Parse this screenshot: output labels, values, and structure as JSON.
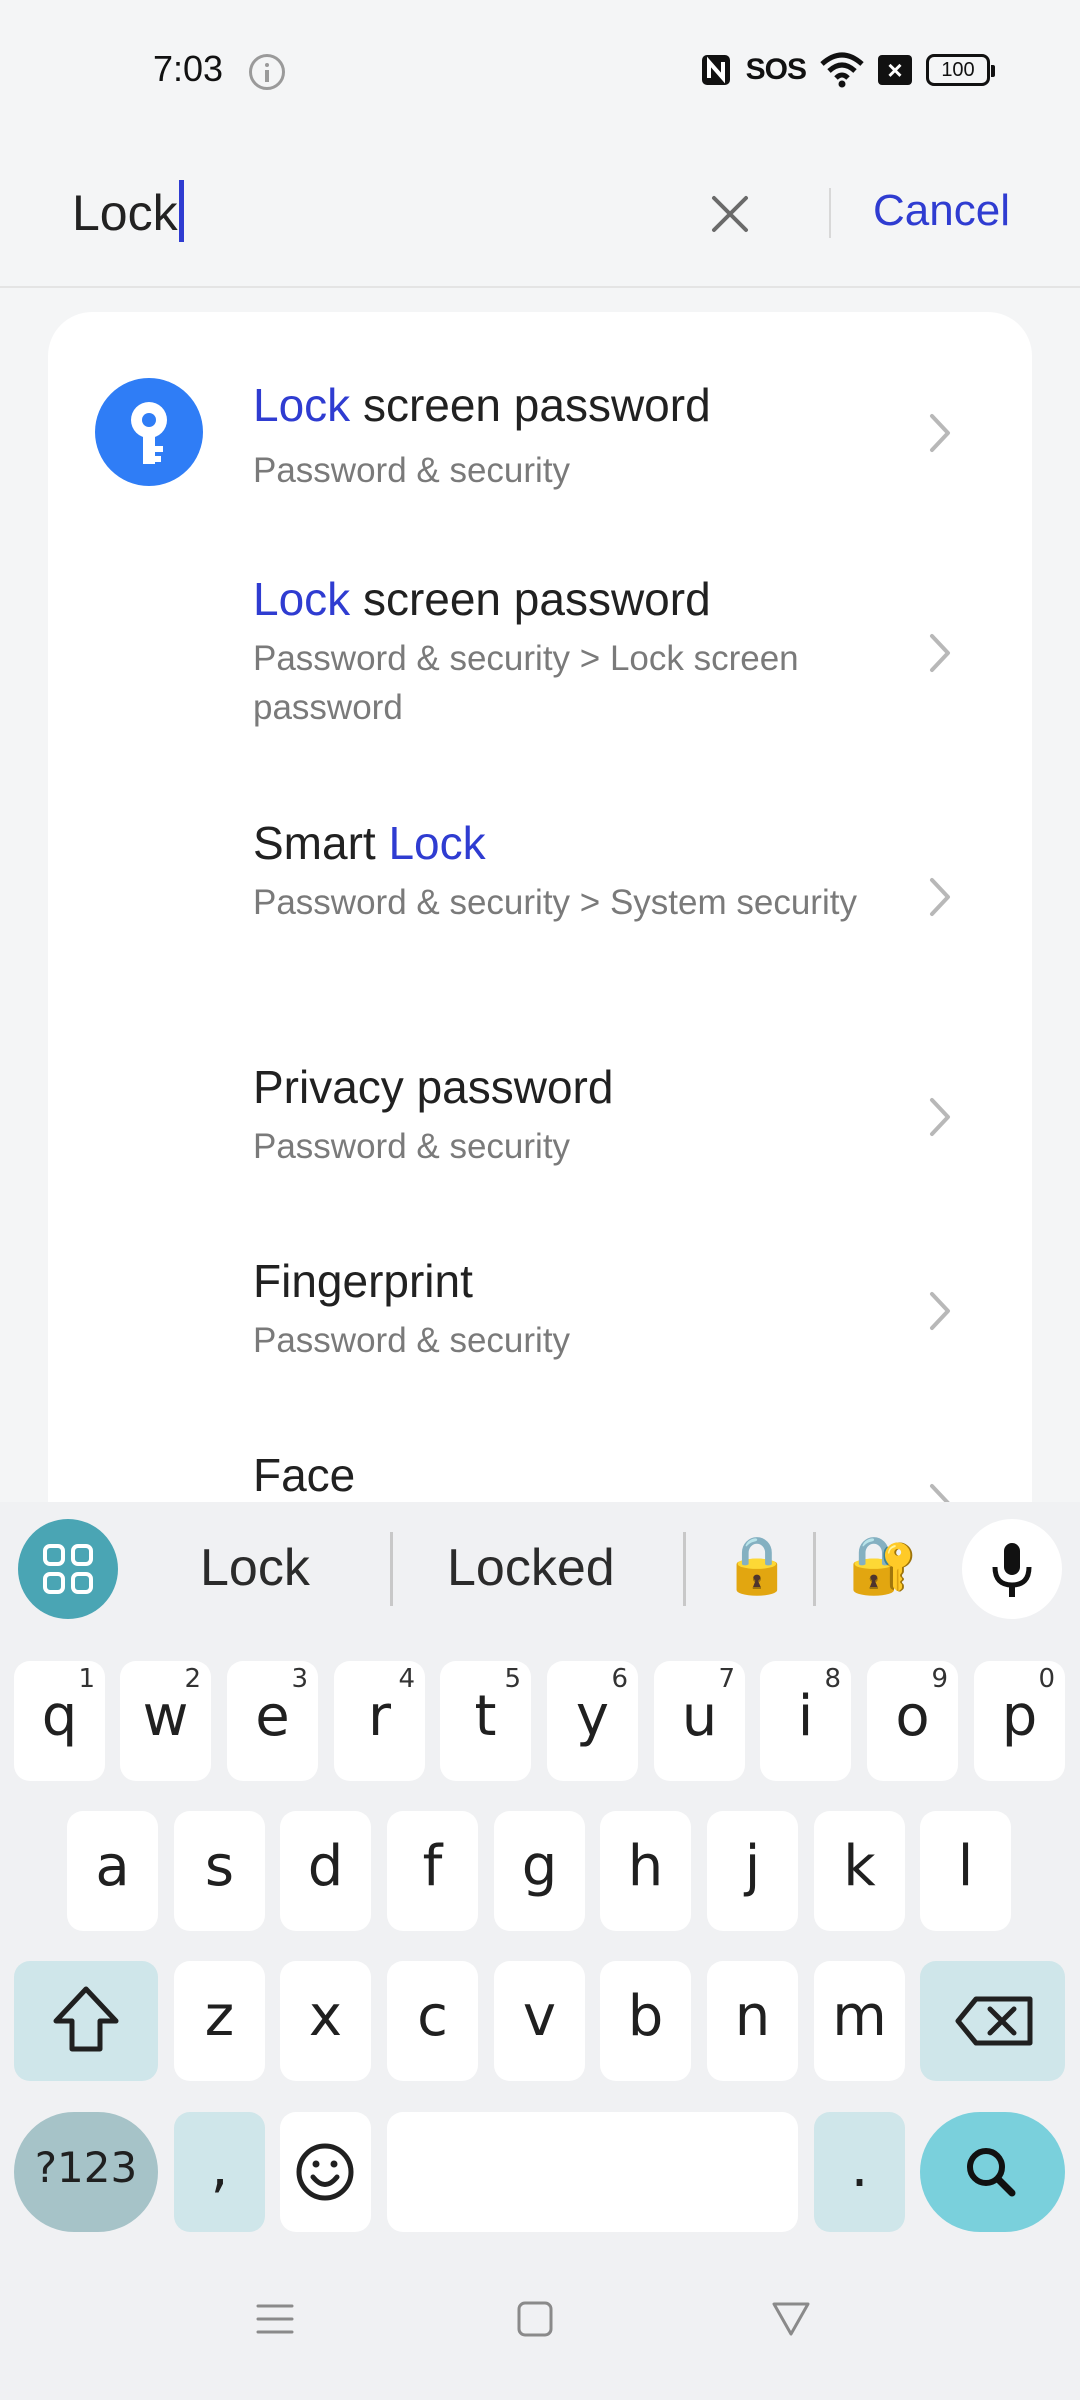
{
  "status_bar": {
    "time": "7:03",
    "sos": "SOS",
    "battery": "100"
  },
  "search": {
    "query": "Lock",
    "cancel_label": "Cancel"
  },
  "results": [
    {
      "title_highlight": "Lock",
      "title_rest": " screen password",
      "subtitle": "Password & security",
      "has_icon": true,
      "icon": "key-icon"
    },
    {
      "title_highlight": "Lock",
      "title_rest": " screen password",
      "subtitle": "Password & security > Lock screen password"
    },
    {
      "title_prefix": "Smart ",
      "title_highlight": "Lock",
      "subtitle": "Password & security > System security"
    },
    {
      "title_rest": "Privacy password",
      "subtitle": "Password & security"
    },
    {
      "title_rest": "Fingerprint",
      "subtitle": "Password & security"
    },
    {
      "title_rest": "Face"
    }
  ],
  "keyboard": {
    "suggestions": [
      "Lock",
      "Locked"
    ],
    "emoji_suggestions": [
      "🔒",
      "🔐"
    ],
    "row1": [
      {
        "key": "q",
        "hint": "1"
      },
      {
        "key": "w",
        "hint": "2"
      },
      {
        "key": "e",
        "hint": "3"
      },
      {
        "key": "r",
        "hint": "4"
      },
      {
        "key": "t",
        "hint": "5"
      },
      {
        "key": "y",
        "hint": "6"
      },
      {
        "key": "u",
        "hint": "7"
      },
      {
        "key": "i",
        "hint": "8"
      },
      {
        "key": "o",
        "hint": "9"
      },
      {
        "key": "p",
        "hint": "0"
      }
    ],
    "row2": [
      "a",
      "s",
      "d",
      "f",
      "g",
      "h",
      "j",
      "k",
      "l"
    ],
    "row3": [
      "z",
      "x",
      "c",
      "v",
      "b",
      "n",
      "m"
    ],
    "symbols_label": "?123",
    "comma": ",",
    "period": ".",
    "icons": {
      "apps": "apps-grid-icon",
      "mic": "microphone-icon",
      "shift": "shift-icon",
      "backspace": "backspace-icon",
      "emoji": "emoji-icon",
      "search": "search-icon"
    },
    "accent_color": "#7ad0dc"
  },
  "nav_bar": {
    "icons": [
      "menu-icon",
      "home-icon",
      "back-icon"
    ]
  },
  "colors": {
    "highlight": "#2f3cd1",
    "result_icon_bg": "#2f7df6"
  }
}
